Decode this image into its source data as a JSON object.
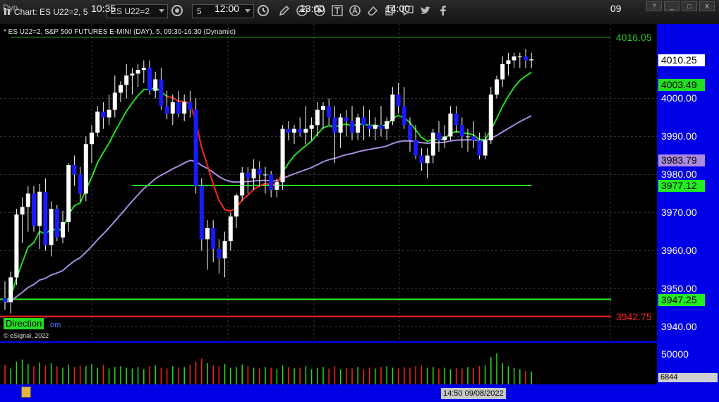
{
  "window": {
    "title": "Chart: ES U22=2, 5",
    "symbol_value": "ES U22=2",
    "interval_value": "5",
    "window_buttons": [
      "?",
      "_",
      "□",
      "X"
    ]
  },
  "toolbar": {
    "icons": [
      "link-icon",
      "pencil-icon",
      "line-tool-icon",
      "play-icon",
      "text-tool-icon",
      "alert-icon",
      "eraser-icon",
      "copy-icon",
      "comment-icon",
      "twitter-icon",
      "facebook-icon"
    ]
  },
  "legend": {
    "text": "* ES U22=2, S&P 500 FUTURES E-MINI (DAY), 5, 09:30-16:30 (Dynamic)",
    "copyright": "© eSignal, 2022",
    "direction_label": "Direction",
    "direction_suffix": "om"
  },
  "price_axis": {
    "ticks": [
      "4000.00",
      "3990.00",
      "3980.00",
      "3970.00",
      "3960.00",
      "3950.00",
      "3940.00"
    ],
    "levels": {
      "top_line": "4016.05",
      "last_price": "4010.25",
      "ma_green": "4003.49",
      "ma_purple": "3983.79",
      "support": "3977.12",
      "low_green": "3947.25",
      "low_red": "3942.75"
    }
  },
  "volume_axis": {
    "tick": "50000",
    "last_volume": "6844"
  },
  "time_axis": {
    "dyn_label": "Dyn",
    "ticks": [
      "10:35",
      "12:00",
      "13:00",
      "14:00",
      "09"
    ],
    "cursor": "14:50 09/08/2022"
  },
  "colors": {
    "background": "#000000",
    "axis_bg": "#0000e6",
    "bull": "#ffffff",
    "bear": "#1a1aff",
    "ma_green": "#22dd22",
    "ma_red": "#ff1a1a",
    "ma_purple": "#a98be0",
    "level_green": "#22ee22",
    "level_red": "#ff2020"
  },
  "chart_data": {
    "type": "candlestick",
    "y_range": [
      3936,
      4023
    ],
    "levels": [
      4016.05,
      3977.12,
      3947.25,
      3942.75
    ],
    "candles": [
      [
        3947.5,
        3952,
        3944.5,
        3946.5
      ],
      [
        3946.5,
        3954.5,
        3943.5,
        3953
      ],
      [
        3953,
        3971,
        3951,
        3969.5
      ],
      [
        3969.5,
        3974,
        3962,
        3971.5
      ],
      [
        3971.5,
        3977,
        3965,
        3975
      ],
      [
        3975,
        3977,
        3965,
        3966.5
      ],
      [
        3966.5,
        3977.5,
        3960.5,
        3975.5
      ],
      [
        3975.5,
        3979,
        3960,
        3961.5
      ],
      [
        3961.5,
        3973,
        3958.5,
        3971
      ],
      [
        3971,
        3972,
        3962.5,
        3963.5
      ],
      [
        3963.5,
        3970.5,
        3962,
        3967.5
      ],
      [
        3967.5,
        3983,
        3965,
        3982.5
      ],
      [
        3982.5,
        3985,
        3977,
        3980
      ],
      [
        3980,
        3982,
        3973,
        3975
      ],
      [
        3975,
        3990,
        3973,
        3988
      ],
      [
        3988,
        3993,
        3983,
        3991
      ],
      [
        3991,
        3998,
        3990,
        3996.5
      ],
      [
        3996.5,
        3999,
        3992,
        3995
      ],
      [
        3995,
        4001,
        3993,
        3997
      ],
      [
        3997,
        4006,
        3995,
        4001.5
      ],
      [
        4001.5,
        4004.5,
        3999,
        4003.5
      ],
      [
        4003.5,
        4009,
        4000,
        4006
      ],
      [
        4006,
        4008,
        4001,
        4006.5
      ],
      [
        4006.5,
        4009,
        4003,
        4007.5
      ],
      [
        4007.5,
        4010,
        4004,
        4008
      ],
      [
        4008,
        4010,
        4001,
        4002
      ],
      [
        4002,
        4007,
        4000,
        4005
      ],
      [
        4005,
        4008,
        3997,
        3998
      ],
      [
        3998,
        4002,
        3994.5,
        3996
      ],
      [
        3996,
        4001,
        3993,
        3999
      ],
      [
        3999,
        4002,
        3995,
        3996
      ],
      [
        3996,
        4001,
        3994,
        3999
      ],
      [
        3999,
        4002,
        3995,
        3997
      ],
      [
        3997,
        4000,
        3975,
        3977
      ],
      [
        3977,
        3979,
        3960,
        3963
      ],
      [
        3963,
        3968,
        3955,
        3966
      ],
      [
        3966,
        3968,
        3957,
        3960.5
      ],
      [
        3960.5,
        3963,
        3954,
        3958
      ],
      [
        3958,
        3965,
        3953,
        3962.5
      ],
      [
        3962.5,
        3970,
        3960,
        3969
      ],
      [
        3969,
        3975,
        3966,
        3974.5
      ],
      [
        3974.5,
        3982,
        3973,
        3980.5
      ],
      [
        3980.5,
        3982,
        3975,
        3979
      ],
      [
        3979,
        3984,
        3976,
        3981.5
      ],
      [
        3981.5,
        3983.5,
        3977,
        3980
      ],
      [
        3980,
        3982,
        3975,
        3980
      ],
      [
        3980,
        3981,
        3974,
        3976
      ],
      [
        3976,
        3979,
        3974,
        3978
      ],
      [
        3978,
        3993,
        3976,
        3992
      ],
      [
        3992,
        3994,
        3989,
        3991
      ],
      [
        3991,
        3993,
        3988,
        3992
      ],
      [
        3992,
        3995,
        3990,
        3991
      ],
      [
        3991,
        3998,
        3988,
        3992
      ],
      [
        3992,
        3995,
        3989,
        3993
      ],
      [
        3993,
        3999,
        3990,
        3997
      ],
      [
        3997,
        3999,
        3992,
        3998
      ],
      [
        3998,
        4000,
        3993,
        3995
      ],
      [
        3995,
        3998,
        3983,
        3991
      ],
      [
        3991,
        3996,
        3987,
        3995
      ],
      [
        3995,
        3997,
        3990,
        3994
      ],
      [
        3994,
        3998,
        3989,
        3991
      ],
      [
        3991,
        3996,
        3989,
        3995
      ],
      [
        3995,
        3998,
        3989,
        3993
      ],
      [
        3993,
        3997,
        3990,
        3992
      ],
      [
        3992,
        3995,
        3989,
        3993
      ],
      [
        3993,
        3998,
        3990,
        3992
      ],
      [
        3992,
        3995,
        3989,
        3994
      ],
      [
        3994,
        4003,
        3993,
        4001
      ],
      [
        4001,
        4004,
        3996,
        3998
      ],
      [
        3998,
        4003,
        3992,
        3993
      ],
      [
        3993,
        3995,
        3986,
        3989
      ],
      [
        3989,
        3993,
        3984,
        3985
      ],
      [
        3985,
        3987,
        3981,
        3983
      ],
      [
        3983,
        3987,
        3979,
        3985
      ],
      [
        3985,
        3992,
        3983,
        3991
      ],
      [
        3991,
        3994,
        3986,
        3989
      ],
      [
        3989,
        3993,
        3987,
        3990
      ],
      [
        3990,
        3998,
        3989,
        3996
      ],
      [
        3996,
        3998,
        3991,
        3993
      ],
      [
        3993,
        3995,
        3987,
        3990
      ],
      [
        3990,
        3992,
        3986,
        3990
      ],
      [
        3990,
        3994,
        3987,
        3989
      ],
      [
        3989,
        3991,
        3984,
        3985
      ],
      [
        3985,
        3991,
        3984,
        3989
      ],
      [
        3989,
        4003,
        3988,
        4001
      ],
      [
        4001,
        4006,
        4000,
        4005
      ],
      [
        4005,
        4011,
        4003,
        4009
      ],
      [
        4009,
        4012,
        4006,
        4010
      ],
      [
        4010,
        4012,
        4008,
        4011
      ],
      [
        4011,
        4012,
        4008,
        4011
      ],
      [
        4011,
        4013,
        4008,
        4010
      ],
      [
        4010,
        4012,
        4008,
        4010.25
      ]
    ],
    "volumes": [
      26000,
      21000,
      30000,
      33000,
      27000,
      24000,
      29000,
      25000,
      28000,
      24000,
      22000,
      26000,
      23000,
      25000,
      24000,
      27000,
      22000,
      26000,
      21000,
      23000,
      24000,
      22000,
      21000,
      23000,
      20000,
      24000,
      25000,
      22000,
      21000,
      24000,
      22000,
      23000,
      26000,
      30000,
      34000,
      28000,
      25000,
      24000,
      27000,
      22000,
      23000,
      26000,
      24000,
      22000,
      21000,
      23000,
      22000,
      20000,
      25000,
      23000,
      21000,
      22000,
      24000,
      20000,
      22000,
      23000,
      21000,
      24000,
      20000,
      22000,
      21000,
      23000,
      20000,
      22000,
      21000,
      23000,
      24000,
      22000,
      21000,
      23000,
      22000,
      24000,
      25000,
      22000,
      23000,
      21000,
      22000,
      20000,
      22000,
      21000,
      23000,
      22000,
      24000,
      25000,
      36000,
      41000,
      28000,
      24000,
      22000,
      20000,
      18000,
      17000
    ],
    "volume_range": [
      0,
      55000
    ],
    "ma_series": [
      {
        "color": "green",
        "last": 4003.49
      },
      {
        "color": "purple",
        "last": 3983.79
      }
    ]
  }
}
